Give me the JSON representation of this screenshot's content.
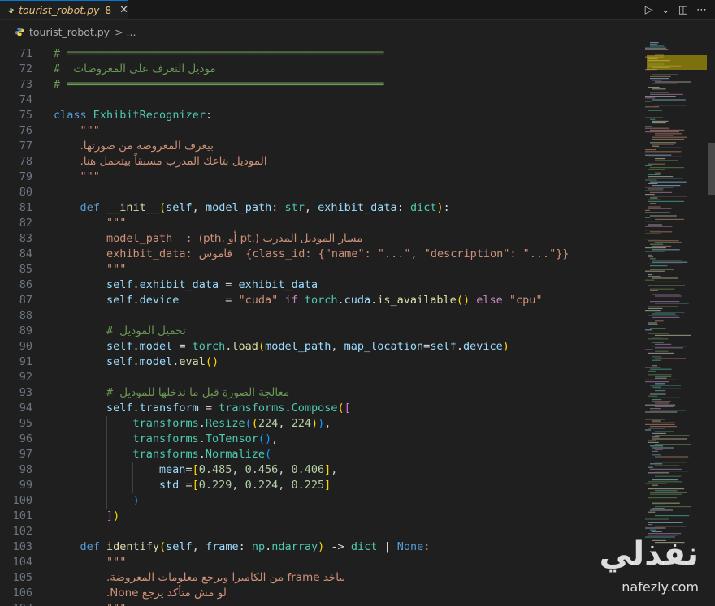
{
  "tab": {
    "filename": "tourist_robot.py",
    "badge": "8",
    "close": "✕"
  },
  "actions": {
    "run": "▷",
    "run_menu": "⌄",
    "split": "◫",
    "more": "⋯"
  },
  "breadcrumb": {
    "file": "tourist_robot.py",
    "sep": "> ..."
  },
  "watermark": {
    "logo": "نفذلي",
    "url": "nafezly.com"
  },
  "colors": {
    "comment": "#6a9955",
    "keyword": "#c586c0",
    "string": "#ce9178"
  },
  "lines": [
    {
      "n": "71",
      "indent": 0,
      "tokens": [
        [
          "c-comment",
          "# ════════════════════════════════════════════════"
        ]
      ]
    },
    {
      "n": "72",
      "indent": 0,
      "tokens": [
        [
          "c-comment",
          "#  "
        ],
        [
          "c-arabic-cmt",
          "موديل التعرف على المعروضات"
        ]
      ]
    },
    {
      "n": "73",
      "indent": 0,
      "tokens": [
        [
          "c-comment",
          "# ════════════════════════════════════════════════"
        ]
      ]
    },
    {
      "n": "74",
      "indent": 0,
      "tokens": []
    },
    {
      "n": "75",
      "indent": 0,
      "tokens": [
        [
          "c-def",
          "class "
        ],
        [
          "c-cls",
          "ExhibitRecognizer"
        ],
        [
          "c-plain",
          ":"
        ]
      ]
    },
    {
      "n": "76",
      "indent": 1,
      "tokens": [
        [
          "c-doc",
          "\"\"\""
        ]
      ]
    },
    {
      "n": "77",
      "indent": 1,
      "tokens": [
        [
          "c-arabic",
          "بيعرف المعروضة من صورتها."
        ]
      ]
    },
    {
      "n": "78",
      "indent": 1,
      "tokens": [
        [
          "c-arabic",
          "الموديل بتاعك المدرب مسبقاً بيتحمل هنا."
        ]
      ]
    },
    {
      "n": "79",
      "indent": 1,
      "tokens": [
        [
          "c-doc",
          "\"\"\""
        ]
      ]
    },
    {
      "n": "80",
      "indent": 1,
      "tokens": []
    },
    {
      "n": "81",
      "indent": 1,
      "tokens": [
        [
          "c-def",
          "def "
        ],
        [
          "c-fn",
          "__init__"
        ],
        [
          "c-br1",
          "("
        ],
        [
          "c-param",
          "self"
        ],
        [
          "c-plain",
          ", "
        ],
        [
          "c-param",
          "model_path"
        ],
        [
          "c-plain",
          ": "
        ],
        [
          "c-cls",
          "str"
        ],
        [
          "c-plain",
          ", "
        ],
        [
          "c-param",
          "exhibit_data"
        ],
        [
          "c-plain",
          ": "
        ],
        [
          "c-cls",
          "dict"
        ],
        [
          "c-br1",
          ")"
        ],
        [
          "c-plain",
          ":"
        ]
      ]
    },
    {
      "n": "82",
      "indent": 2,
      "tokens": [
        [
          "c-doc",
          "\"\"\""
        ]
      ]
    },
    {
      "n": "83",
      "indent": 2,
      "tokens": [
        [
          "c-doc",
          "model_path  : "
        ],
        [
          "c-arabic",
          "مسار الموديل المدرب (.pt أو .pth)"
        ]
      ]
    },
    {
      "n": "84",
      "indent": 2,
      "tokens": [
        [
          "c-doc",
          "exhibit_data: "
        ],
        [
          "c-arabic",
          "قاموس"
        ],
        [
          "c-doc",
          "  {class_id: {\"name\": \"...\", \"description\": \"...\"}}"
        ]
      ]
    },
    {
      "n": "85",
      "indent": 2,
      "tokens": [
        [
          "c-doc",
          "\"\"\""
        ]
      ]
    },
    {
      "n": "86",
      "indent": 2,
      "tokens": [
        [
          "c-var",
          "self"
        ],
        [
          "c-plain",
          "."
        ],
        [
          "c-var",
          "exhibit_data"
        ],
        [
          "c-plain",
          " = "
        ],
        [
          "c-var",
          "exhibit_data"
        ]
      ]
    },
    {
      "n": "87",
      "indent": 2,
      "tokens": [
        [
          "c-var",
          "self"
        ],
        [
          "c-plain",
          "."
        ],
        [
          "c-var",
          "device"
        ],
        [
          "c-plain",
          "       = "
        ],
        [
          "c-str",
          "\"cuda\""
        ],
        [
          "c-kw",
          " if "
        ],
        [
          "c-cls",
          "torch"
        ],
        [
          "c-plain",
          "."
        ],
        [
          "c-var",
          "cuda"
        ],
        [
          "c-plain",
          "."
        ],
        [
          "c-fn",
          "is_available"
        ],
        [
          "c-br1",
          "()"
        ],
        [
          "c-kw",
          " else "
        ],
        [
          "c-str",
          "\"cpu\""
        ]
      ]
    },
    {
      "n": "88",
      "indent": 2,
      "tokens": []
    },
    {
      "n": "89",
      "indent": 2,
      "tokens": [
        [
          "c-comment",
          "# "
        ],
        [
          "c-arabic-cmt",
          "تحميل الموديل"
        ]
      ]
    },
    {
      "n": "90",
      "indent": 2,
      "tokens": [
        [
          "c-var",
          "self"
        ],
        [
          "c-plain",
          "."
        ],
        [
          "c-var",
          "model"
        ],
        [
          "c-plain",
          " = "
        ],
        [
          "c-cls",
          "torch"
        ],
        [
          "c-plain",
          "."
        ],
        [
          "c-fn",
          "load"
        ],
        [
          "c-br1",
          "("
        ],
        [
          "c-var",
          "model_path"
        ],
        [
          "c-plain",
          ", "
        ],
        [
          "c-var",
          "map_location"
        ],
        [
          "c-plain",
          "="
        ],
        [
          "c-var",
          "self"
        ],
        [
          "c-plain",
          "."
        ],
        [
          "c-var",
          "device"
        ],
        [
          "c-br1",
          ")"
        ]
      ]
    },
    {
      "n": "91",
      "indent": 2,
      "tokens": [
        [
          "c-var",
          "self"
        ],
        [
          "c-plain",
          "."
        ],
        [
          "c-var",
          "model"
        ],
        [
          "c-plain",
          "."
        ],
        [
          "c-fn",
          "eval"
        ],
        [
          "c-br1",
          "()"
        ]
      ]
    },
    {
      "n": "92",
      "indent": 2,
      "tokens": []
    },
    {
      "n": "93",
      "indent": 2,
      "tokens": [
        [
          "c-comment",
          "# "
        ],
        [
          "c-arabic-cmt",
          "معالجة الصورة قبل ما ندخلها للموديل"
        ]
      ]
    },
    {
      "n": "94",
      "indent": 2,
      "tokens": [
        [
          "c-var",
          "self"
        ],
        [
          "c-plain",
          "."
        ],
        [
          "c-var",
          "transform"
        ],
        [
          "c-plain",
          " = "
        ],
        [
          "c-cls",
          "transforms"
        ],
        [
          "c-plain",
          "."
        ],
        [
          "c-cls",
          "Compose"
        ],
        [
          "c-br1",
          "("
        ],
        [
          "c-br2",
          "["
        ]
      ]
    },
    {
      "n": "95",
      "indent": 3,
      "tokens": [
        [
          "c-cls",
          "transforms"
        ],
        [
          "c-plain",
          "."
        ],
        [
          "c-cls",
          "Resize"
        ],
        [
          "c-br3",
          "("
        ],
        [
          "c-br1",
          "("
        ],
        [
          "c-num",
          "224"
        ],
        [
          "c-plain",
          ", "
        ],
        [
          "c-num",
          "224"
        ],
        [
          "c-br1",
          ")"
        ],
        [
          "c-br3",
          ")"
        ],
        [
          "c-plain",
          ","
        ]
      ]
    },
    {
      "n": "96",
      "indent": 3,
      "tokens": [
        [
          "c-cls",
          "transforms"
        ],
        [
          "c-plain",
          "."
        ],
        [
          "c-cls",
          "ToTensor"
        ],
        [
          "c-br3",
          "()"
        ],
        [
          "c-plain",
          ","
        ]
      ]
    },
    {
      "n": "97",
      "indent": 3,
      "tokens": [
        [
          "c-cls",
          "transforms"
        ],
        [
          "c-plain",
          "."
        ],
        [
          "c-cls",
          "Normalize"
        ],
        [
          "c-br3",
          "("
        ]
      ]
    },
    {
      "n": "98",
      "indent": 4,
      "tokens": [
        [
          "c-param",
          "mean"
        ],
        [
          "c-plain",
          "="
        ],
        [
          "c-br1",
          "["
        ],
        [
          "c-num",
          "0.485"
        ],
        [
          "c-plain",
          ", "
        ],
        [
          "c-num",
          "0.456"
        ],
        [
          "c-plain",
          ", "
        ],
        [
          "c-num",
          "0.406"
        ],
        [
          "c-br1",
          "]"
        ],
        [
          "c-plain",
          ","
        ]
      ]
    },
    {
      "n": "99",
      "indent": 4,
      "tokens": [
        [
          "c-param",
          "std"
        ],
        [
          "c-plain",
          " ="
        ],
        [
          "c-br1",
          "["
        ],
        [
          "c-num",
          "0.229"
        ],
        [
          "c-plain",
          ", "
        ],
        [
          "c-num",
          "0.224"
        ],
        [
          "c-plain",
          ", "
        ],
        [
          "c-num",
          "0.225"
        ],
        [
          "c-br1",
          "]"
        ]
      ]
    },
    {
      "n": "100",
      "indent": 3,
      "tokens": [
        [
          "c-br3",
          ")"
        ]
      ]
    },
    {
      "n": "101",
      "indent": 2,
      "tokens": [
        [
          "c-br2",
          "]"
        ],
        [
          "c-br1",
          ")"
        ]
      ]
    },
    {
      "n": "102",
      "indent": 1,
      "tokens": []
    },
    {
      "n": "103",
      "indent": 1,
      "tokens": [
        [
          "c-def",
          "def "
        ],
        [
          "c-fn",
          "identify"
        ],
        [
          "c-br1",
          "("
        ],
        [
          "c-param",
          "self"
        ],
        [
          "c-plain",
          ", "
        ],
        [
          "c-param",
          "frame"
        ],
        [
          "c-plain",
          ": "
        ],
        [
          "c-cls",
          "np"
        ],
        [
          "c-plain",
          "."
        ],
        [
          "c-cls",
          "ndarray"
        ],
        [
          "c-br1",
          ")"
        ],
        [
          "c-plain",
          " -> "
        ],
        [
          "c-cls",
          "dict"
        ],
        [
          "c-plain",
          " | "
        ],
        [
          "c-def",
          "None"
        ],
        [
          "c-plain",
          ":"
        ]
      ]
    },
    {
      "n": "104",
      "indent": 2,
      "tokens": [
        [
          "c-doc",
          "\"\"\""
        ]
      ]
    },
    {
      "n": "105",
      "indent": 2,
      "tokens": [
        [
          "c-arabic",
          "بياخد frame من الكاميرا ويرجع معلومات المعروضة."
        ]
      ]
    },
    {
      "n": "106",
      "indent": 2,
      "tokens": [
        [
          "c-arabic",
          "لو مش متأكد يرجع None."
        ]
      ]
    },
    {
      "n": "107",
      "indent": 2,
      "tokens": [
        [
          "c-doc",
          "\"\"\""
        ]
      ]
    }
  ]
}
